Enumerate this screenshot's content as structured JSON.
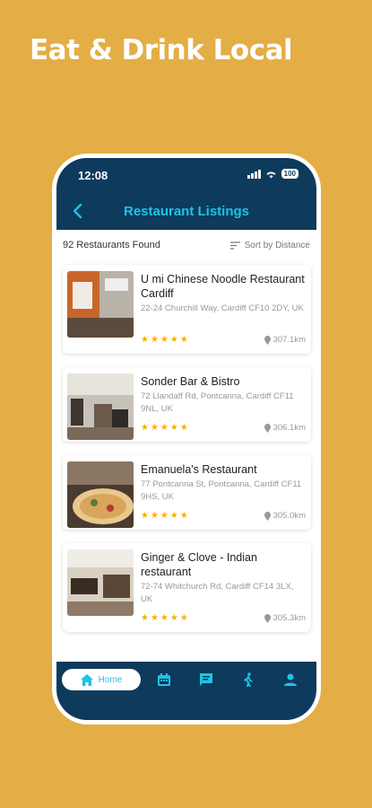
{
  "headline": "Eat & Drink Local",
  "status_bar": {
    "time": "12:08",
    "battery": "100"
  },
  "nav": {
    "title": "Restaurant Listings"
  },
  "list": {
    "count_label": "92 Restaurants Found",
    "sort_label": "Sort by Distance"
  },
  "restaurants": [
    {
      "name": "U mi Chinese Noodle Restaurant Cardiff",
      "address": "22-24 Churchill Way, Cardiff CF10 2DY, UK",
      "rating": 5,
      "distance": "307.1km"
    },
    {
      "name": "Sonder Bar & Bistro",
      "address": "72 Llandaff Rd, Pontcanna, Cardiff CF11 9NL, UK",
      "rating": 5,
      "distance": "306.1km"
    },
    {
      "name": "Emanuela's Restaurant",
      "address": "77 Pontcanna St, Pontcanna, Cardiff CF11 9HS, UK",
      "rating": 5,
      "distance": "305.0km"
    },
    {
      "name": "Ginger & Clove - Indian restaurant",
      "address": "72-74 Whitchurch Rd, Cardiff CF14 3LX, UK",
      "rating": 5,
      "distance": "305.3km"
    }
  ],
  "tabs": {
    "home_label": "Home",
    "icons": [
      "home-icon",
      "calendar-icon",
      "chat-icon",
      "walk-icon",
      "person-icon"
    ]
  },
  "colors": {
    "background": "#E3AE45",
    "navy": "#0E3A5C",
    "accent": "#1EC3E6",
    "star": "#F5B301"
  }
}
